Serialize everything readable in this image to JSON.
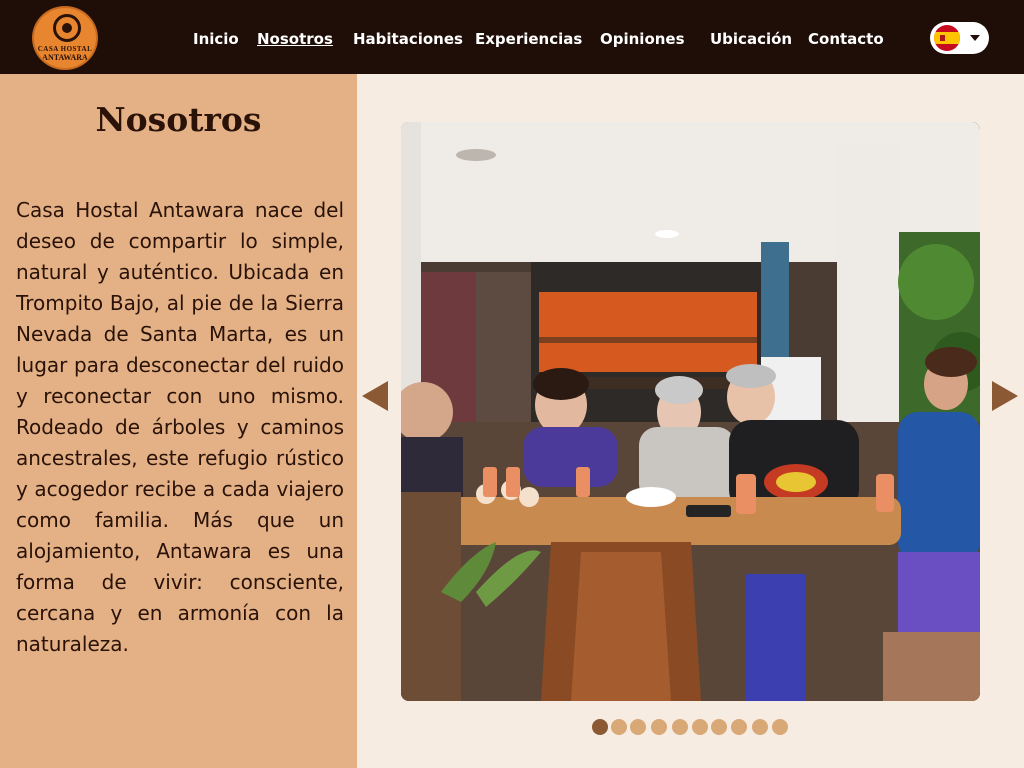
{
  "brand": {
    "logo_line1": "CASA HOSTAL",
    "logo_line2": "ANTAWARA",
    "logo_icon": "sun-emblem-icon"
  },
  "nav": {
    "items": [
      {
        "label": "Inicio",
        "active": false
      },
      {
        "label": "Nosotros",
        "active": true
      },
      {
        "label": "Habitaciones",
        "active": false
      },
      {
        "label": "Experiencias",
        "active": false
      },
      {
        "label": "Opiniones",
        "active": false
      },
      {
        "label": "Ubicación",
        "active": false
      },
      {
        "label": "Contacto",
        "active": false
      }
    ]
  },
  "language": {
    "flag_icon": "spain-flag-icon",
    "caret_icon": "chevron-down-icon"
  },
  "about": {
    "title": "Nosotros",
    "description": "Casa Hostal Antawara nace del deseo de compartir lo simple, natural y auténtico. Ubicada en Trompito Bajo, al pie de la Sierra Nevada de Santa Marta, es un lugar para desconectar del ruido y reconectar con uno mismo. Rodeado de árboles y caminos ancestrales, este refugio rústico y acogedor recibe a cada viajero como familia. Más que un alojamiento, Antawara es una forma de vivir: consciente, cercana y en armonía con la naturaleza."
  },
  "carousel": {
    "prev_icon": "triangle-left-icon",
    "next_icon": "triangle-right-icon",
    "current_slide": 1,
    "total_slides": 10
  },
  "colors": {
    "header_bg": "#1f0e07",
    "left_panel_bg": "#e3b185",
    "page_bg": "#f7ece2",
    "accent_brown": "#8b5a34",
    "dot_inactive": "#d9a877",
    "logo_orange": "#e8852f"
  }
}
